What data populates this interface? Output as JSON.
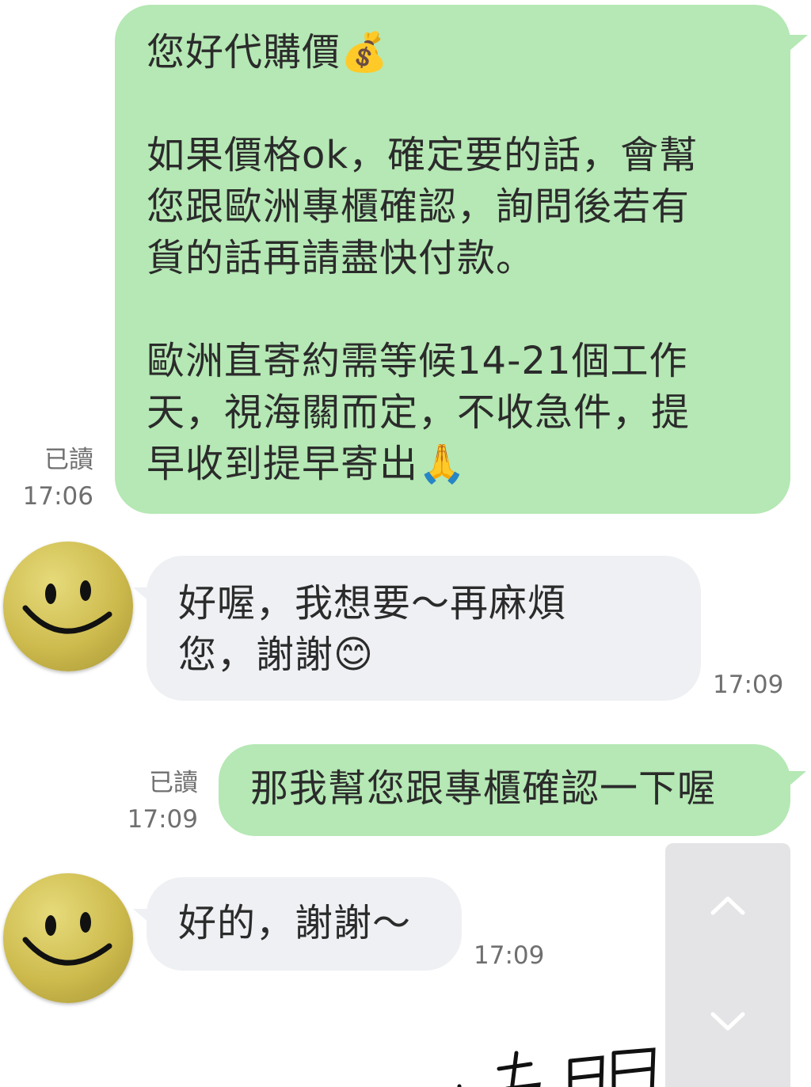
{
  "messages": [
    {
      "direction": "outgoing",
      "text": "您好代購價💰\n\n如果價格ok，確定要的話，會幫\n您跟歐洲專櫃確認，詢問後若有\n貨的話再請盡快付款。\n\n歐洲直寄約需等候14-21個工作\n天，視海關而定，不收急件，提\n早收到提早寄出🙏",
      "read": "已讀",
      "time": "17:06"
    },
    {
      "direction": "incoming",
      "text": "好喔，我想要～再麻煩\n您，謝謝😊",
      "time": "17:09"
    },
    {
      "direction": "outgoing",
      "text": "那我幫您跟專櫃確認一下喔",
      "read": "已讀",
      "time": "17:09"
    },
    {
      "direction": "incoming",
      "text": "好的，謝謝～",
      "time": "17:09"
    }
  ],
  "scroll": {
    "up_icon": "chevron-up-icon",
    "down_icon": "chevron-down-icon"
  },
  "overlay": {
    "handwriting": "有問題"
  },
  "colors": {
    "outgoing_bubble": "#b5e8b4",
    "incoming_bubble": "#eef0f3",
    "meta_text": "#6f6f6f"
  }
}
